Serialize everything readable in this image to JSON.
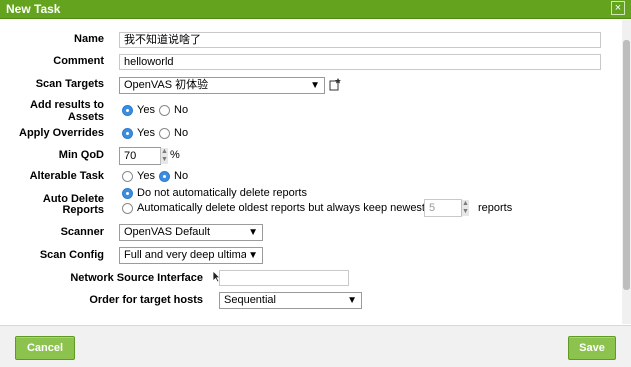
{
  "dialog": {
    "title": "New Task",
    "close_glyph": "×"
  },
  "form": {
    "name": {
      "label": "Name",
      "value": "我不知道说啥了"
    },
    "comment": {
      "label": "Comment",
      "value": "helloworld"
    },
    "scan_targets": {
      "label": "Scan Targets",
      "value": "OpenVAS 初体验",
      "arrow": "▼"
    },
    "add_results": {
      "label_line1": "Add results to",
      "label_line2": "Assets",
      "yes": "Yes",
      "no": "No",
      "selected": "Yes"
    },
    "apply_overrides": {
      "label": "Apply Overrides",
      "yes": "Yes",
      "no": "No",
      "selected": "Yes"
    },
    "min_qod": {
      "label": "Min QoD",
      "value": "70",
      "unit": "%"
    },
    "alterable": {
      "label": "Alterable Task",
      "yes": "Yes",
      "no": "No",
      "selected": "No"
    },
    "auto_delete": {
      "label_line1": "Auto Delete",
      "label_line2": "Reports",
      "option1": "Do not automatically delete reports",
      "option2": "Automatically delete oldest reports but always keep newest",
      "keep_value": "5",
      "keep_suffix": "reports"
    },
    "scanner": {
      "label": "Scanner",
      "value": "OpenVAS Default",
      "arrow": "▼"
    },
    "scan_config": {
      "label": "Scan Config",
      "value": "Full and very deep ultima",
      "arrow": "▼"
    },
    "network_source": {
      "label": "Network Source Interface",
      "value": ""
    },
    "target_order": {
      "label": "Order for target hosts",
      "value": "Sequential",
      "arrow": "▼"
    }
  },
  "footer": {
    "cancel": "Cancel",
    "save": "Save"
  },
  "colors": {
    "titlebar": "#63a31e",
    "button": "#8cc34f",
    "radio_selected": "#3b8de0"
  }
}
